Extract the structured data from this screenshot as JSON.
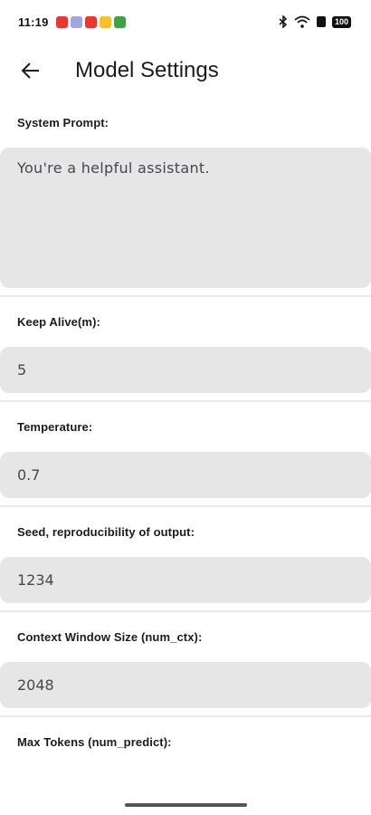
{
  "status_bar": {
    "time": "11:19",
    "battery": "100",
    "notification_colors": [
      "#e53935",
      "#9fa8da",
      "#e53935",
      "#fbc02d",
      "#43a047"
    ]
  },
  "header": {
    "title": "Model Settings",
    "back_icon": "arrow-left-icon"
  },
  "settings": [
    {
      "label": "System Prompt:",
      "value": "You're a helpful assistant."
    },
    {
      "label": "Keep Alive(m):",
      "value": "5"
    },
    {
      "label": "Temperature:",
      "value": "0.7"
    },
    {
      "label": "Seed, reproducibility of output:",
      "value": "1234"
    },
    {
      "label": "Context Window Size (num_ctx):",
      "value": "2048"
    },
    {
      "label": "Max Tokens (num_predict):",
      "value": ""
    }
  ],
  "colors": {
    "field_background": "#e6e6e6",
    "divider": "#e8e8e8"
  }
}
